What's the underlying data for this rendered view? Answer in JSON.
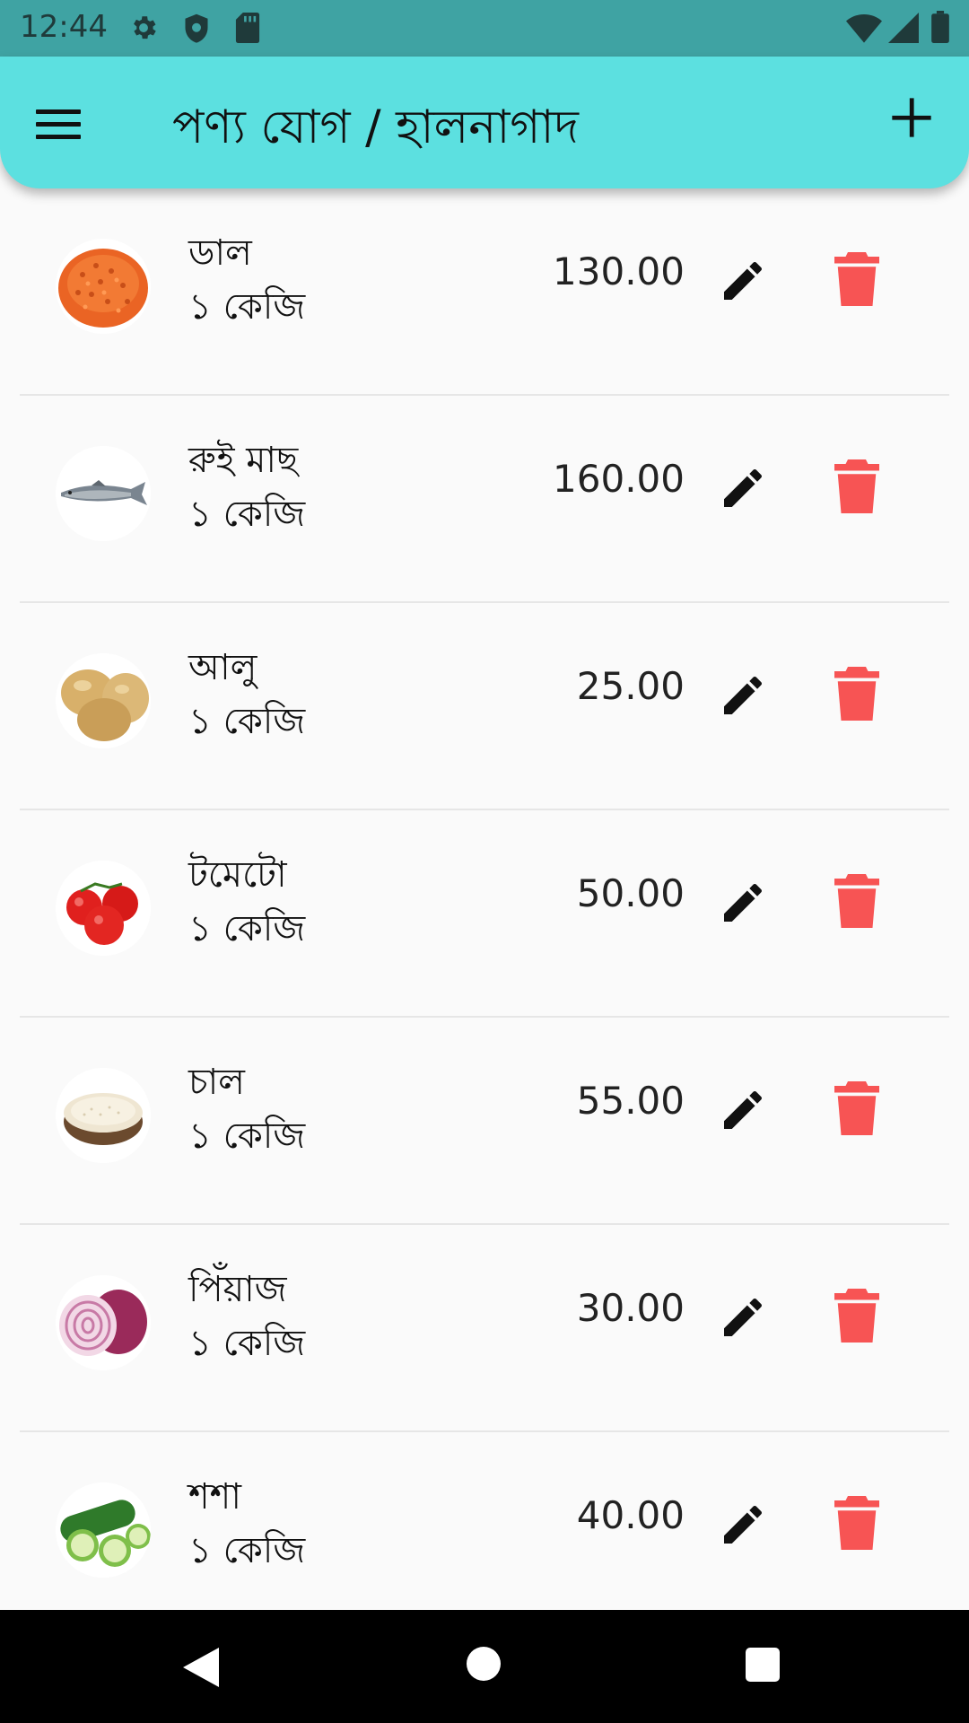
{
  "status_bar": {
    "time": "12:44",
    "icons": [
      "gear-icon",
      "shield-icon",
      "sd-card-icon",
      "wifi-icon",
      "signal-icon",
      "battery-icon"
    ]
  },
  "app_bar": {
    "title": "পণ্য যোগ / হালনাগাদ",
    "menu_icon": "menu-icon",
    "add_icon": "add-icon",
    "color": "#5ce0e0"
  },
  "products": [
    {
      "name": "ডাল",
      "unit": "১ কেজি",
      "price": "130.00",
      "image": "lentils"
    },
    {
      "name": "রুই মাছ",
      "unit": "১ কেজি",
      "price": "160.00",
      "image": "fish"
    },
    {
      "name": "আলু",
      "unit": "১ কেজি",
      "price": "25.00",
      "image": "potato"
    },
    {
      "name": "টমেটো",
      "unit": "১ কেজি",
      "price": "50.00",
      "image": "tomato"
    },
    {
      "name": "চাল",
      "unit": "১ কেজি",
      "price": "55.00",
      "image": "rice"
    },
    {
      "name": "পিঁয়াজ",
      "unit": "১ কেজি",
      "price": "30.00",
      "image": "onion"
    },
    {
      "name": "শশা",
      "unit": "১ কেজি",
      "price": "40.00",
      "image": "cucumber"
    }
  ],
  "row_icons": {
    "edit": "edit-icon",
    "delete": "delete-icon"
  },
  "colors": {
    "delete": "#f75454",
    "edit": "#111111",
    "status_bar": "#3fa3a3"
  },
  "nav_bar": {
    "icons": [
      "back-icon",
      "home-icon",
      "recents-icon"
    ]
  }
}
